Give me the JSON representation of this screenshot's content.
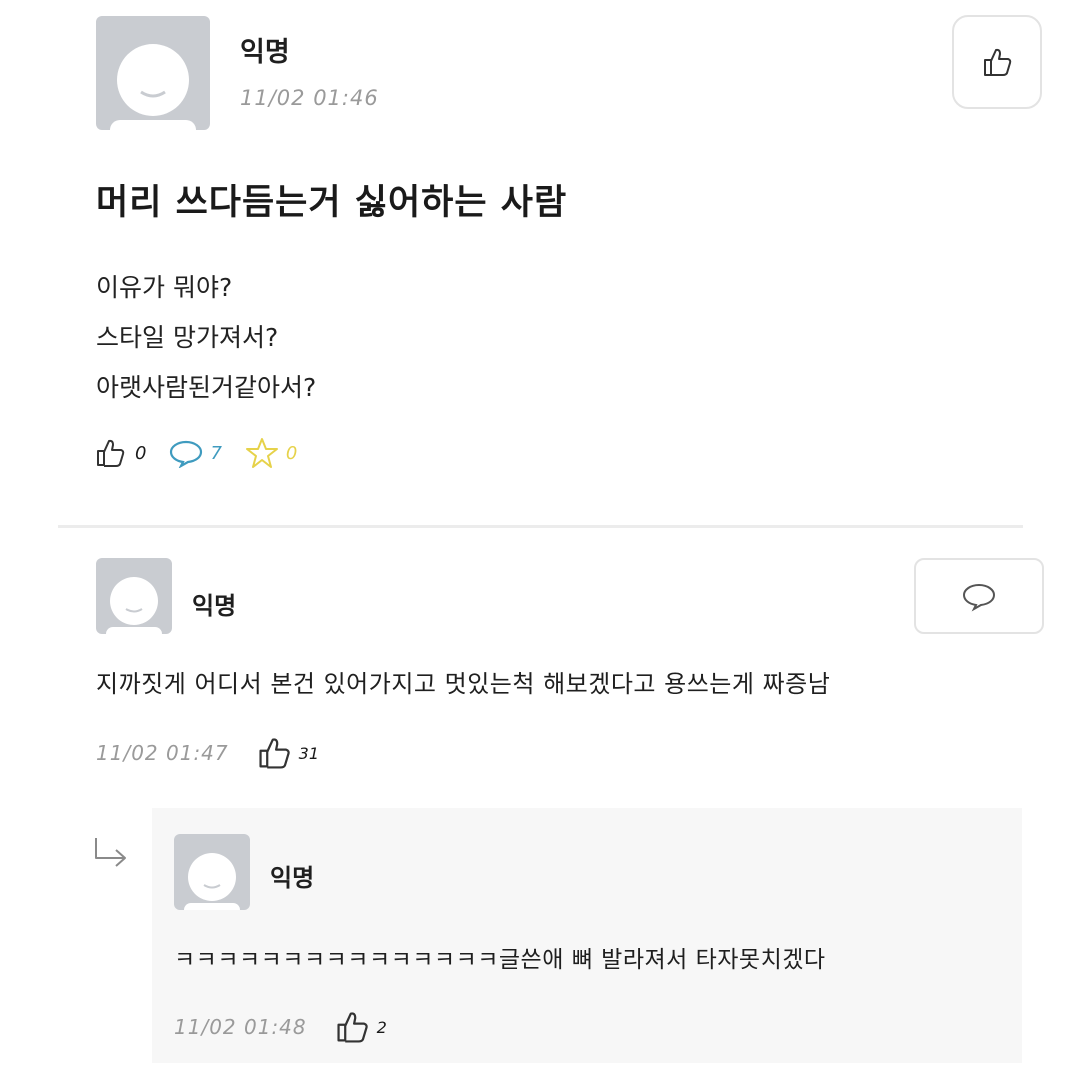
{
  "post": {
    "author": "익명",
    "time": "11/02 01:46",
    "title": "머리 쓰다듬는거 싫어하는 사람",
    "body_lines": [
      "이유가 뭐야?",
      "스타일 망가져서?",
      "아랫사람된거같아서?"
    ],
    "stats": {
      "likes": "0",
      "comments": "7",
      "scraps": "0"
    }
  },
  "comments": [
    {
      "author": "익명",
      "text": "지까짓게 어디서 본건 있어가지고 멋있는척 해보겠다고 용쓰는게 짜증남",
      "time": "11/02 01:47",
      "likes": "31"
    }
  ],
  "replies": [
    {
      "author": "익명",
      "text": "ㅋㅋㅋㅋㅋㅋㅋㅋㅋㅋㅋㅋㅋㅋㅋ글쓴애 뼈 발라져서 타자못치겠다",
      "time": "11/02 01:48",
      "likes": "2"
    }
  ],
  "colors": {
    "comment_icon": "#3f9bbf",
    "star_icon": "#e6d24a",
    "avatar_bg": "#c9ccd1"
  },
  "icons": {
    "like": "thumbs-up-icon",
    "comment": "speech-bubble-icon",
    "scrap": "star-icon",
    "reply_arrow": "reply-arrow-icon"
  }
}
